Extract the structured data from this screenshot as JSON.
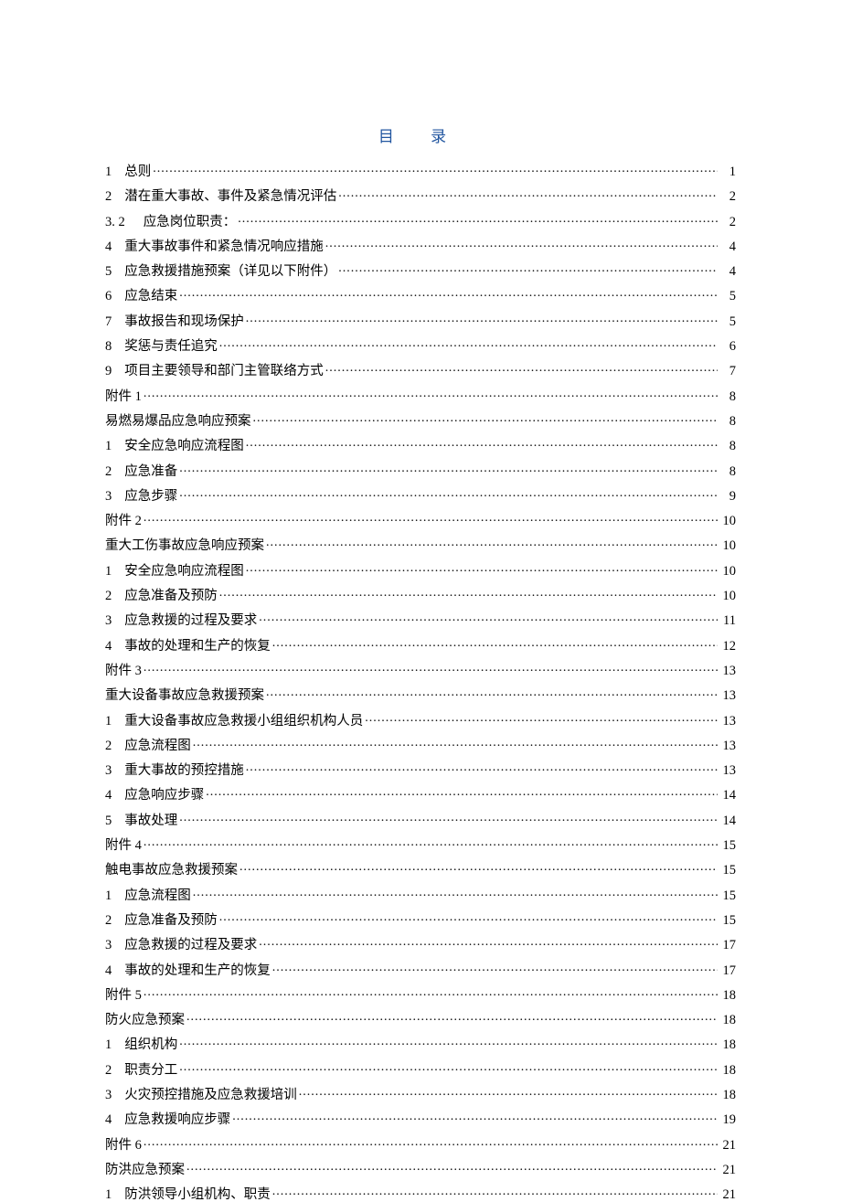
{
  "title": "目 录",
  "toc": [
    {
      "num": "1",
      "label": "总则",
      "page": "1"
    },
    {
      "num": "2",
      "label": "潜在重大事故、事件及紧急情况评估",
      "page": "2"
    },
    {
      "num": "3. 2",
      "label": "应急岗位职责：",
      "page": "2",
      "wide": true
    },
    {
      "num": "4",
      "label": "重大事故事件和紧急情况响应措施",
      "page": "4"
    },
    {
      "num": "5",
      "label": "应急救援措施预案（详见以下附件）",
      "page": "4"
    },
    {
      "num": "6",
      "label": "应急结束",
      "page": "5"
    },
    {
      "num": "7",
      "label": "事故报告和现场保护",
      "page": "5"
    },
    {
      "num": "8",
      "label": "奖惩与责任追究",
      "page": "6"
    },
    {
      "num": "9",
      "label": "项目主要领导和部门主管联络方式",
      "page": "7"
    },
    {
      "num": "",
      "label": "附件 1  ",
      "page": "8"
    },
    {
      "num": "",
      "label": "易燃易爆品应急响应预案",
      "page": "8"
    },
    {
      "num": "1",
      "label": "安全应急响应流程图",
      "page": "8"
    },
    {
      "num": "2",
      "label": "应急准备",
      "page": "8"
    },
    {
      "num": "3",
      "label": "应急步骤",
      "page": "9"
    },
    {
      "num": "",
      "label": "附件 2",
      "page": "10"
    },
    {
      "num": "",
      "label": "重大工伤事故应急响应预案",
      "page": "10"
    },
    {
      "num": "1",
      "label": "安全应急响应流程图",
      "page": "10"
    },
    {
      "num": "2",
      "label": "应急准备及预防",
      "page": "10"
    },
    {
      "num": "3",
      "label": "应急救援的过程及要求",
      "page": "11"
    },
    {
      "num": "4",
      "label": "事故的处理和生产的恢复",
      "page": "12"
    },
    {
      "num": "",
      "label": "附件 3",
      "page": "13"
    },
    {
      "num": "",
      "label": "重大设备事故应急救援预案",
      "page": "13"
    },
    {
      "num": "1",
      "label": "重大设备事故应急救援小组组织机构人员",
      "page": "13"
    },
    {
      "num": "2",
      "label": "应急流程图",
      "page": "13"
    },
    {
      "num": "3",
      "label": "重大事故的预控措施",
      "page": "13"
    },
    {
      "num": "4",
      "label": "应急响应步骤",
      "page": "14"
    },
    {
      "num": "5",
      "label": "事故处理",
      "page": "14"
    },
    {
      "num": "",
      "label": "附件 4",
      "page": "15"
    },
    {
      "num": "",
      "label": "触电事故应急救援预案",
      "page": "15"
    },
    {
      "num": "1",
      "label": "应急流程图",
      "page": "15"
    },
    {
      "num": "2",
      "label": "应急准备及预防",
      "page": "15"
    },
    {
      "num": "3",
      "label": "应急救援的过程及要求",
      "page": "17"
    },
    {
      "num": "4",
      "label": "事故的处理和生产的恢复",
      "page": "17"
    },
    {
      "num": "",
      "label": "附件 5",
      "page": "18"
    },
    {
      "num": "",
      "label": "防火应急预案",
      "page": "18"
    },
    {
      "num": "1",
      "label": "组织机构",
      "page": "18"
    },
    {
      "num": "2",
      "label": "职责分工",
      "page": "18"
    },
    {
      "num": "3",
      "label": "火灾预控措施及应急救援培训",
      "page": "18"
    },
    {
      "num": "4",
      "label": "应急救援响应步骤",
      "page": "19"
    },
    {
      "num": "",
      "label": "附件 6",
      "page": "21"
    },
    {
      "num": "",
      "label": "防洪应急预案",
      "page": "21"
    },
    {
      "num": "1",
      "label": "防洪领导小组机构、职责",
      "page": "21"
    }
  ]
}
